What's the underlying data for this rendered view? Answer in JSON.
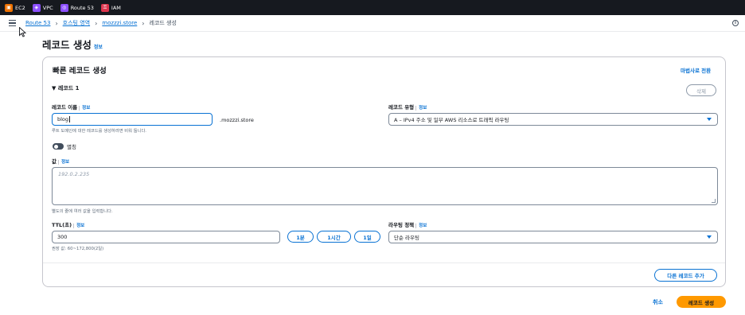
{
  "topbar": {
    "services": [
      {
        "label": "EC2",
        "icon": "ec2-icon",
        "color": "#ed7100"
      },
      {
        "label": "VPC",
        "icon": "vpc-icon",
        "color": "#8c4fff"
      },
      {
        "label": "Route 53",
        "icon": "route53-icon",
        "color": "#8c4fff"
      },
      {
        "label": "IAM",
        "icon": "iam-icon",
        "color": "#dd344c"
      }
    ]
  },
  "breadcrumb": {
    "items": [
      "Route 53",
      "호스팅 영역",
      "mozzzi.store",
      "레코드 생성"
    ]
  },
  "page": {
    "title": "레코드 생성",
    "info": "정보"
  },
  "card": {
    "title": "빠른 레코드 생성",
    "wizard_link": "마법사로 전환",
    "record_header": "▼ 레코드 1",
    "delete_label": "삭제",
    "record_name": {
      "label": "레코드 이름",
      "info": "정보",
      "value": "blog",
      "suffix": ".mozzzi.store",
      "hint": "루트 도메인에 대한 레코드를 생성하려면 비워 둡니다."
    },
    "record_type": {
      "label": "레코드 유형",
      "info": "정보",
      "value": "A – IPv4 주소 및 일부 AWS 리소스로 트래픽 라우팅"
    },
    "alias": {
      "label": "별칭",
      "enabled": false
    },
    "value_field": {
      "label": "값",
      "info": "정보",
      "placeholder": "192.0.2.235",
      "hint": "별도의 줄에 여러 값을 입력합니다."
    },
    "ttl": {
      "label": "TTL(초)",
      "info": "정보",
      "value": "300",
      "hint": "권장 값: 60~172,800(2일)",
      "buttons": [
        "1분",
        "1시간",
        "1일"
      ]
    },
    "routing_policy": {
      "label": "라우팅 정책",
      "info": "정보",
      "value": "단순 라우팅"
    },
    "add_record_label": "다른 레코드 추가"
  },
  "footer": {
    "cancel": "취소",
    "create": "레코드 생성"
  },
  "colors": {
    "accent": "#0972d3",
    "primary_button": "#ff9900",
    "topbar": "#16191f"
  }
}
